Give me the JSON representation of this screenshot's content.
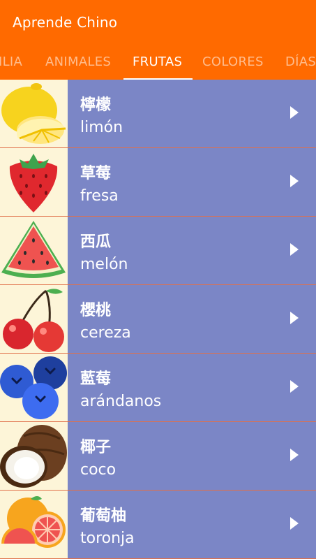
{
  "app": {
    "title": "Aprende Chino"
  },
  "tabs": [
    {
      "label": "ILIA"
    },
    {
      "label": "ANIMALES"
    },
    {
      "label": "FRUTAS"
    },
    {
      "label": "COLORES"
    },
    {
      "label": "DÍAS"
    }
  ],
  "active_tab": "FRUTAS",
  "items": [
    {
      "chinese": "檸檬",
      "spanish": "limón",
      "icon": "lemon-icon"
    },
    {
      "chinese": "草莓",
      "spanish": "fresa",
      "icon": "strawberry-icon"
    },
    {
      "chinese": "西瓜",
      "spanish": "melón",
      "icon": "watermelon-icon"
    },
    {
      "chinese": "櫻桃",
      "spanish": "cereza",
      "icon": "cherry-icon"
    },
    {
      "chinese": "藍莓",
      "spanish": "arándanos",
      "icon": "blueberry-icon"
    },
    {
      "chinese": "椰子",
      "spanish": "coco",
      "icon": "coconut-icon"
    },
    {
      "chinese": "葡萄柚",
      "spanish": "toronja",
      "icon": "grapefruit-icon"
    }
  ],
  "colors": {
    "app_bar": "#ff6a00",
    "list_background": "#7b86c6",
    "thumb_background": "#fdf5d8",
    "divider": "#e0704a"
  }
}
